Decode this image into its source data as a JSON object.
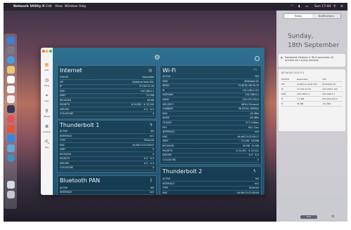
{
  "menubar": {
    "apple": "",
    "app_name": "Network Utility X",
    "menus": [
      "Edit",
      "View",
      "Window",
      "Help"
    ],
    "clock": "Sun 17:44"
  },
  "sidebar": {
    "items": [
      {
        "label": "Info",
        "icon": "info-icon",
        "glyph": "▦"
      },
      {
        "label": "Ping",
        "icon": "ping-icon",
        "glyph": "◷"
      },
      {
        "label": "Geo",
        "icon": "geo-icon",
        "glyph": "⌖"
      },
      {
        "label": "Whois",
        "icon": "whois-icon",
        "glyph": "⚲"
      },
      {
        "label": "Lookup",
        "icon": "lookup-icon",
        "glyph": "≣"
      },
      {
        "label": "Dig",
        "icon": "dig-icon",
        "glyph": "⛏"
      }
    ]
  },
  "panels": {
    "internet": {
      "title": "Internet",
      "rows": [
        [
          "STATUS",
          "Reachable"
        ],
        [
          "ISP",
          "Vodafone Italia DSL"
        ],
        [
          "IP",
          "37.182.21.50"
        ],
        [
          "DNS",
          "192.168.0.1"
        ],
        [
          "SENT",
          "3.2 MB"
        ],
        [
          "RECEIVED",
          "56 MB"
        ],
        [
          "PACKETS",
          "⇅ 24,381 · ⇅ 22,541"
        ],
        [
          "ERRORS",
          "⇅ 0 · ⇅ 0"
        ],
        [
          "COLLISIONS",
          "0"
        ]
      ]
    },
    "thunderbolt1": {
      "title": "Thunderbolt 1",
      "rows": [
        [
          "ACTIVE",
          "NO"
        ],
        [
          "INTERFACE",
          "en1"
        ],
        [
          "TYPE",
          "Ethernet"
        ],
        [
          "MAC",
          "b4:88:C3:CD:E8:07"
        ],
        [
          "SENT",
          "0"
        ],
        [
          "RECEIVED",
          "0"
        ],
        [
          "PACKETS",
          "⇅ 0 · ⇅ 0"
        ],
        [
          "ERRORS",
          "⇅ 0 · ⇅ 0"
        ],
        [
          "COLLISIONS",
          "0"
        ]
      ]
    },
    "bluetooth": {
      "title": "Bluetooth PAN",
      "rows": [
        [
          "ACTIVE",
          "NO"
        ],
        [
          "INTERFACE",
          "en3"
        ]
      ]
    },
    "wifi": {
      "title": "Wi-Fi",
      "rows": [
        [
          "ACTIVE",
          "YES"
        ],
        [
          "SSID",
          "Whiteball-5G"
        ],
        [
          "BSSID",
          "70:8F:9C:98:7A:70"
        ],
        [
          "IP",
          "192.168.0.122"
        ],
        [
          "GATEWAY",
          "192.168.0.1"
        ],
        [
          "MASK",
          "255.255.255.0"
        ],
        [
          "SECURITY",
          "WPA-2 Personal"
        ],
        [
          "CHANNEL",
          "36 (5GHz, 80MHz)"
        ],
        [
          "RSSI",
          "-59 dBm"
        ],
        [
          "NOISE",
          "-95 dBm"
        ],
        [
          "TX RATE",
          "577.0 Mbps"
        ],
        [
          "PHY",
          "802.11ac"
        ],
        [
          "INTERFACE",
          "en0"
        ],
        [
          "MAC",
          "a4:d8:C3:CD:E8:17"
        ],
        [
          "SENT",
          "3.2 MB · 5.8 MB"
        ],
        [
          "RECEIVED",
          "56 MB · 51 MB"
        ],
        [
          "PACKETS",
          "⇅ 24,381 · ⇅ 22,541"
        ],
        [
          "ERRORS",
          "⇅ 0 · ⇅ 0"
        ],
        [
          "COLLISIONS",
          "0"
        ]
      ]
    },
    "thunderbolt2": {
      "title": "Thunderbolt 2",
      "rows": [
        [
          "ACTIVE",
          "NO"
        ],
        [
          "INTERFACE",
          "en2"
        ],
        [
          "TYPE",
          "Ethernet"
        ],
        [
          "MAC",
          "b4:88:C3:CD:E8:08"
        ]
      ]
    }
  },
  "notification_center": {
    "tabs": [
      "Today",
      "Notifications"
    ],
    "day": "Sunday,",
    "date": "18th September",
    "alert": "Dashboard: Network X: Wi-Fi connected. All services are running normally.",
    "widget_title": "NETWORK UTILITY X",
    "widget_rows": [
      [
        "STATUS",
        "Reachable",
        "YES"
      ],
      [
        "ISP",
        "Vodafone Italia DSL",
        "Whiteball-5G"
      ],
      [
        "IP",
        "37.182.21.50",
        "192.168.0.122"
      ],
      [
        "DNS",
        "192.168.0.1",
        "192.168.0.1"
      ],
      [
        "⇅",
        "3.2 MB",
        "255.255.255.0"
      ],
      [
        "⇅",
        "56 MB",
        "-59 dBm"
      ]
    ],
    "edit_label": "Edit",
    "settings_icon": "gear-icon"
  }
}
